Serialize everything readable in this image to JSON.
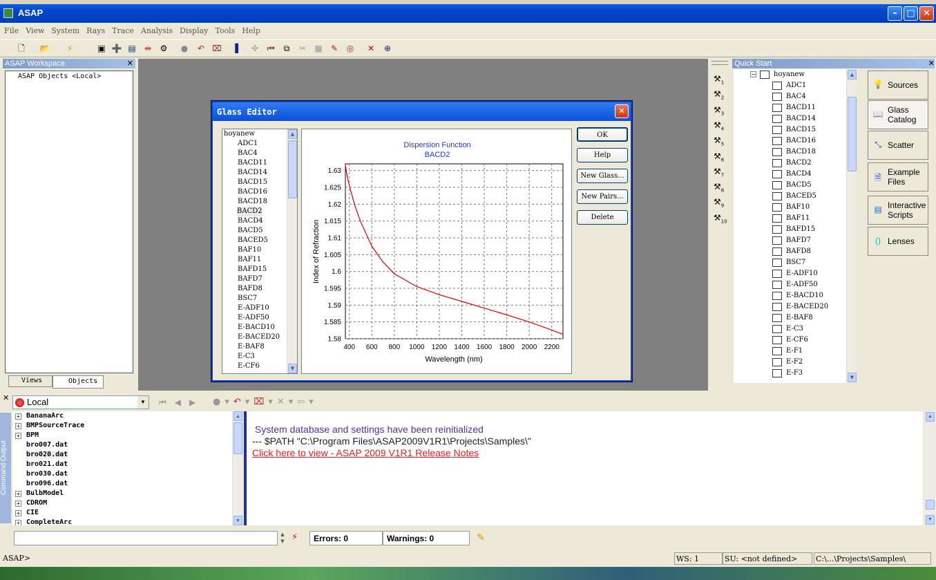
{
  "app": {
    "title": "ASAP",
    "min_icon": "minimize-icon",
    "max_icon": "maximize-icon",
    "close_icon": "close-icon"
  },
  "menu": [
    "File",
    "View",
    "System",
    "Rays",
    "Trace",
    "Analysis",
    "Display",
    "Tools",
    "Help"
  ],
  "workspace": {
    "title": "ASAP Workspace",
    "tree_root": "ASAP Objects <Local>",
    "tabs": [
      "Views",
      "Objects"
    ]
  },
  "glass_editor": {
    "title": "Glass Editor",
    "list": [
      "hoyanew",
      "ADC1",
      "BAC4",
      "BACD11",
      "BACD14",
      "BACD15",
      "BACD16",
      "BACD18",
      "BACD2",
      "BACD4",
      "BACD5",
      "BACED5",
      "BAF10",
      "BAF11",
      "BAFD15",
      "BAFD7",
      "BAFD8",
      "BSC7",
      "E-ADF10",
      "E-ADF50",
      "E-BACD10",
      "E-BACED20",
      "E-BAF8",
      "E-C3",
      "E-CF6"
    ],
    "buttons": [
      "OK",
      "Help",
      "New Glass...",
      "New Pairs...",
      "Delete"
    ]
  },
  "chart_data": {
    "type": "line",
    "title": "Dispersion Function",
    "subtitle": "BACD2",
    "xlabel": "Wavelength (nm)",
    "ylabel": "Index of Refraction",
    "xlim": [
      365,
      2300
    ],
    "ylim": [
      1.58,
      1.632
    ],
    "xticks": [
      400,
      600,
      800,
      1000,
      1200,
      1400,
      1600,
      1800,
      2000,
      2200
    ],
    "yticks": [
      1.58,
      1.585,
      1.59,
      1.595,
      1.6,
      1.605,
      1.61,
      1.615,
      1.62,
      1.625,
      1.63
    ],
    "grid": true,
    "color": "#e00000",
    "x": [
      365,
      380,
      400,
      450,
      500,
      600,
      700,
      800,
      1000,
      1200,
      1400,
      1600,
      1800,
      2000,
      2200,
      2300
    ],
    "y": [
      1.6315,
      1.6285,
      1.6255,
      1.6195,
      1.6148,
      1.6075,
      1.6028,
      1.5993,
      1.5955,
      1.5931,
      1.5911,
      1.5891,
      1.5871,
      1.585,
      1.5826,
      1.5813
    ]
  },
  "tool_numbers": [
    "1",
    "2",
    "3",
    "4",
    "5",
    "6",
    "7",
    "8",
    "9",
    "10"
  ],
  "quick_start": {
    "title": "Quick Start",
    "root": "hoyanew",
    "items": [
      "ADC1",
      "BAC4",
      "BACD11",
      "BACD14",
      "BACD15",
      "BACD16",
      "BACD18",
      "BACD2",
      "BACD4",
      "BACD5",
      "BACED5",
      "BAF10",
      "BAF11",
      "BAFD15",
      "BAFD7",
      "BAFD8",
      "BSC7",
      "E-ADF10",
      "E-ADF50",
      "E-BACD10",
      "E-BACED20",
      "E-BAF8",
      "E-C3",
      "E-CF6",
      "E-F1",
      "E-F2",
      "E-F3"
    ],
    "buttons": [
      {
        "label": "Sources",
        "icon": "lightbulb-icon"
      },
      {
        "label": "Glass Catalog",
        "icon": "book-icon"
      },
      {
        "label": "Scatter",
        "icon": "scatter-icon"
      },
      {
        "label": "Example Files",
        "icon": "document-icon"
      },
      {
        "label": "Interactive Scripts",
        "icon": "script-icon"
      },
      {
        "label": "Lenses",
        "icon": "lens-icon"
      }
    ]
  },
  "command_output": {
    "side_label": "Command Output",
    "context": "Local",
    "files": [
      {
        "name": "BananaArc",
        "folder": true
      },
      {
        "name": "BMPSourceTrace",
        "folder": true
      },
      {
        "name": "BPM",
        "folder": true
      },
      {
        "name": "bro007.dat",
        "folder": false
      },
      {
        "name": "bro020.dat",
        "folder": false
      },
      {
        "name": "bro021.dat",
        "folder": false
      },
      {
        "name": "bro030.dat",
        "folder": false
      },
      {
        "name": "bro096.dat",
        "folder": false
      },
      {
        "name": "BulbModel",
        "folder": true
      },
      {
        "name": "CDROM",
        "folder": true
      },
      {
        "name": "CIE",
        "folder": true
      },
      {
        "name": "CompleteArc",
        "folder": true
      }
    ],
    "lines": [
      {
        "text": "System database and settings have been reinitialized",
        "color": "#5a2d9a"
      },
      {
        "text": "--- $PATH \"C:\\Program Files\\ASAP2009V1R1\\Projects\\Samples\\\"",
        "color": "#222222"
      },
      {
        "text": "Click here to view - ASAP 2009 V1R1 Release Notes",
        "color": "#e02020"
      }
    ]
  },
  "cmd": {
    "errors": "Errors: 0",
    "warnings": "Warnings: 0"
  },
  "status": {
    "prompt": "ASAP>",
    "ws": "WS:  1",
    "su": "SU:  <not defined>",
    "path": "C:\\...\\Projects\\Samples\\"
  }
}
